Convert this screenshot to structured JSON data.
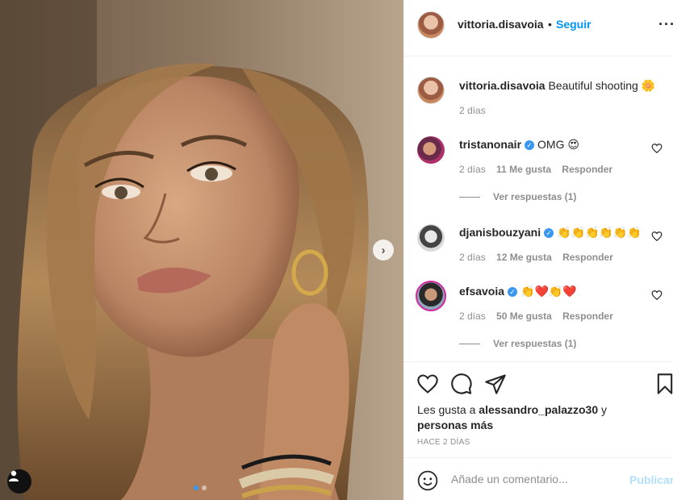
{
  "post": {
    "author": "vittoria.disavoia",
    "separator": "•",
    "follow_label": "Seguir",
    "more_label": "···",
    "caption": "Beautiful shooting 🌼",
    "caption_time": "2 días",
    "carousel_index": 0,
    "carousel_count": 2
  },
  "comments": [
    {
      "user": "tristanonair",
      "verified": true,
      "text": "OMG 😍",
      "time": "2 días",
      "likes": "11 Me gusta",
      "reply_label": "Responder",
      "view_replies": "Ver respuestas (1)"
    },
    {
      "user": "djanisbouzyani",
      "verified": true,
      "text": "👏👏👏👏👏👏",
      "time": "2 días",
      "likes": "12 Me gusta",
      "reply_label": "Responder"
    },
    {
      "user": "efsavoia",
      "verified": true,
      "text": "👏❤️👏❤️",
      "time": "2 días",
      "likes": "50 Me gusta",
      "reply_label": "Responder",
      "view_replies": "Ver respuestas (1)"
    }
  ],
  "likes": {
    "prefix": "Les gusta a",
    "user": "alessandro_palazzo30",
    "conj": "y",
    "suffix": "personas más"
  },
  "time_ago": "HACE 2 DÍAS",
  "add_comment": {
    "placeholder": "Añade un comentario...",
    "publish_label": "Publicar"
  },
  "colors": {
    "accent": "#0095f6",
    "publish_disabled": "#b2dffc",
    "muted": "#8e8e8e",
    "text": "#262626"
  },
  "icons": [
    "heart-icon",
    "comment-icon",
    "share-icon",
    "bookmark-icon",
    "emoji-icon",
    "user-tag-icon",
    "chevron-right-icon",
    "verified-icon"
  ]
}
